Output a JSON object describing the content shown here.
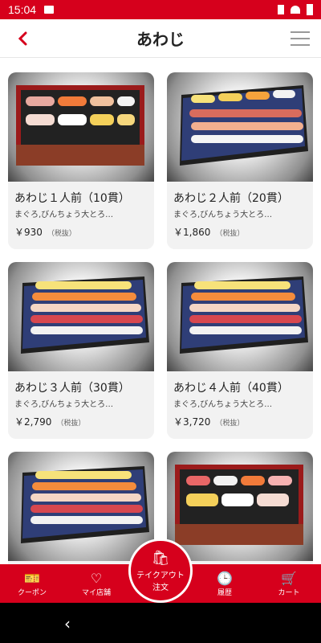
{
  "status": {
    "time": "15:04"
  },
  "header": {
    "title": "あわじ"
  },
  "icons": {
    "back": "back-arrow-icon",
    "menu": "hamburger-icon",
    "coupon": "coupon-icon",
    "myshop": "heart-icon",
    "history": "clock-icon",
    "cart": "cart-icon",
    "takeout": "takeout-bag-icon",
    "nav_back": "nav-back-icon"
  },
  "colors": {
    "brand": "#d6001c"
  },
  "items": [
    {
      "name": "あわじ１人前（10貫）",
      "desc": "まぐろ,びんちょう大とろ…",
      "price": "￥930",
      "tax": "（税抜）"
    },
    {
      "name": "あわじ２人前（20貫）",
      "desc": "まぐろ,びんちょう大とろ…",
      "price": "￥1,860",
      "tax": "（税抜）"
    },
    {
      "name": "あわじ３人前（30貫）",
      "desc": "まぐろ,びんちょう大とろ…",
      "price": "￥2,790",
      "tax": "（税抜）"
    },
    {
      "name": "あわじ４人前（40貫）",
      "desc": "まぐろ,びんちょう大とろ…",
      "price": "￥3,720",
      "tax": "（税抜）"
    },
    {
      "name": "",
      "desc": "",
      "price": "",
      "tax": ""
    },
    {
      "name": "",
      "desc": "",
      "price": "",
      "tax": ""
    }
  ],
  "tabbar": {
    "coupon": "クーポン",
    "myshop": "マイ店舗",
    "takeout_line1": "テイクアウト",
    "takeout_line2": "注文",
    "history": "履歴",
    "cart": "カート"
  }
}
